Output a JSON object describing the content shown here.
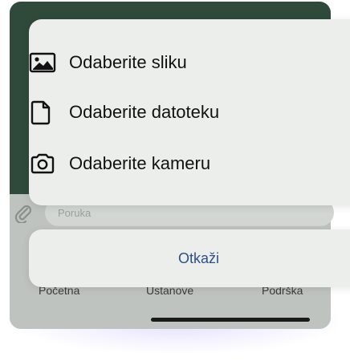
{
  "background": {
    "message_placeholder": "Poruka",
    "tabs": [
      "Početna",
      "Ustanove",
      "Podrška"
    ]
  },
  "action_sheet": {
    "items": [
      {
        "label": "Odaberite sliku",
        "icon": "image-icon"
      },
      {
        "label": "Odaberite datoteku",
        "icon": "file-icon"
      },
      {
        "label": "Odaberite kameru",
        "icon": "camera-icon"
      }
    ],
    "cancel_label": "Otkaži"
  },
  "colors": {
    "accent": "#2d4f8a",
    "sheet_bg": "#eceeec",
    "backdrop_top": "#2f4a3a"
  }
}
